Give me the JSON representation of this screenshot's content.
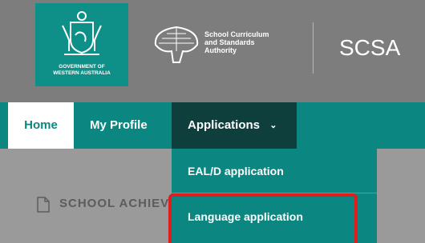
{
  "header": {
    "crest_caption_line1": "GOVERNMENT OF",
    "crest_caption_line2": "WESTERN AUSTRALIA",
    "org_line1": "School Curriculum",
    "org_line2": "and Standards",
    "org_line3": "Authority",
    "org_abbrev": "SCSA"
  },
  "nav": {
    "home": "Home",
    "profile": "My Profile",
    "applications": "Applications",
    "chevron": "⌄"
  },
  "dropdown": {
    "items": [
      {
        "label": "EAL/D application"
      },
      {
        "label": "Language application"
      }
    ]
  },
  "page": {
    "section_title": "SCHOOL ACHIEV"
  },
  "colors": {
    "teal": "#0c8680",
    "dark_teal": "#0f3f3c",
    "highlight_red": "#e01c1c"
  }
}
